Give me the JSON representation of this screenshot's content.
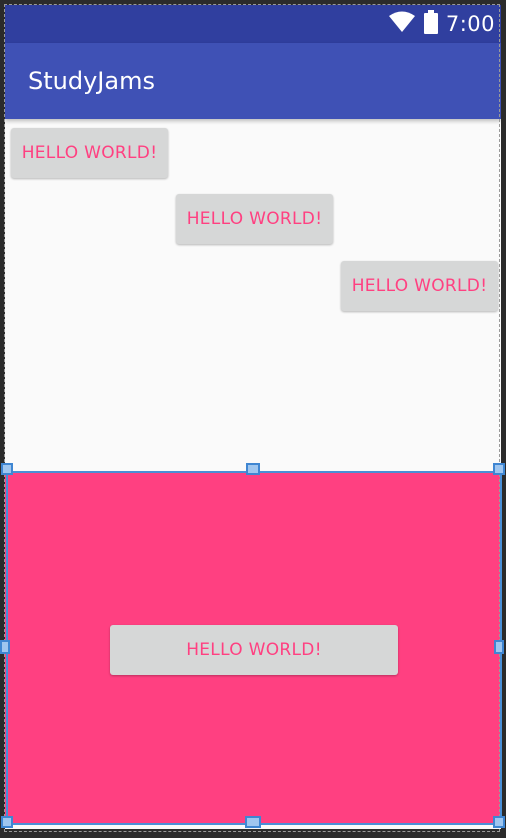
{
  "status_bar": {
    "time": "7:00",
    "icons": [
      "wifi-icon",
      "battery-icon"
    ],
    "color": "#303f9f"
  },
  "app_bar": {
    "title": "StudyJams",
    "color": "#3f51b5"
  },
  "content": {
    "buttons": [
      {
        "label": "HELLO WORLD!"
      },
      {
        "label": "HELLO WORLD!"
      },
      {
        "label": "HELLO WORLD!"
      }
    ],
    "background": "#fafafa"
  },
  "bottom_panel": {
    "background": "#ff4081",
    "button": {
      "label": "HELLO WORLD!"
    },
    "selected": true
  },
  "colors": {
    "accent": "#ff4081",
    "button_bg": "#d6d7d7",
    "selection": "#4a8fd6"
  }
}
